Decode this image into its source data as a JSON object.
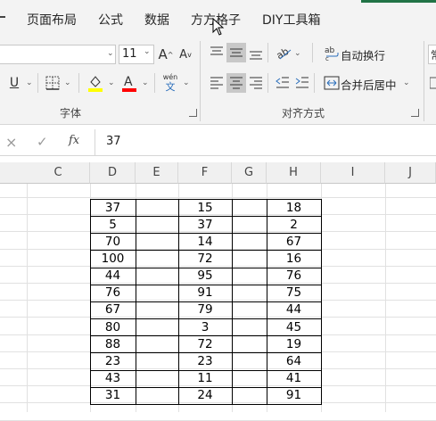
{
  "tabs": [
    "页面布局",
    "公式",
    "数据",
    "方方格子",
    "DIY工具箱"
  ],
  "ribbon": {
    "font_size": "11",
    "phonetic_top": "wén",
    "phonetic_bottom": "文",
    "wrap_text": "自动换行",
    "merge_center": "合并后居中",
    "group_font": "字体",
    "group_align": "对齐方式",
    "right_cut": "常"
  },
  "formula_bar": {
    "cancel": "×",
    "confirm": "✓",
    "fx": "fx",
    "value": "37"
  },
  "columns": [
    "C",
    "D",
    "E",
    "F",
    "G",
    "H",
    "I",
    "J"
  ],
  "table": {
    "D": [
      "37",
      "5",
      "70",
      "100",
      "44",
      "76",
      "67",
      "80",
      "88",
      "23",
      "43",
      "31"
    ],
    "F": [
      "15",
      "37",
      "14",
      "72",
      "95",
      "91",
      "79",
      "3",
      "72",
      "23",
      "11",
      "24"
    ],
    "H": [
      "18",
      "2",
      "67",
      "16",
      "76",
      "75",
      "44",
      "45",
      "19",
      "64",
      "41",
      "91"
    ]
  },
  "colors": {
    "accent_green": "#217346",
    "highlight_yellow": "#ffff00",
    "font_red": "#ff0000"
  }
}
